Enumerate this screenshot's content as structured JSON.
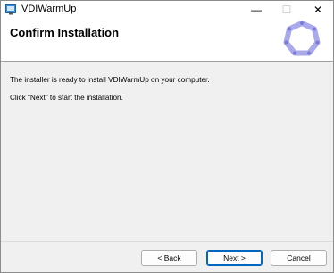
{
  "window": {
    "title": "VDIWarmUp",
    "minimize_glyph": "—",
    "maximize_glyph": "☐",
    "close_glyph": "✕"
  },
  "banner": {
    "title": "Confirm Installation",
    "logo_icon": "heptagon-logo-icon",
    "logo_color": "#8f8fe0"
  },
  "content": {
    "line1": "The installer is ready to install VDIWarmUp on your computer.",
    "line2": "Click \"Next\" to start the installation."
  },
  "buttons": {
    "back_label": "< Back",
    "next_label": "Next >",
    "cancel_label": "Cancel"
  },
  "colors": {
    "accent": "#0067c0",
    "background": "#f0f0f0"
  }
}
